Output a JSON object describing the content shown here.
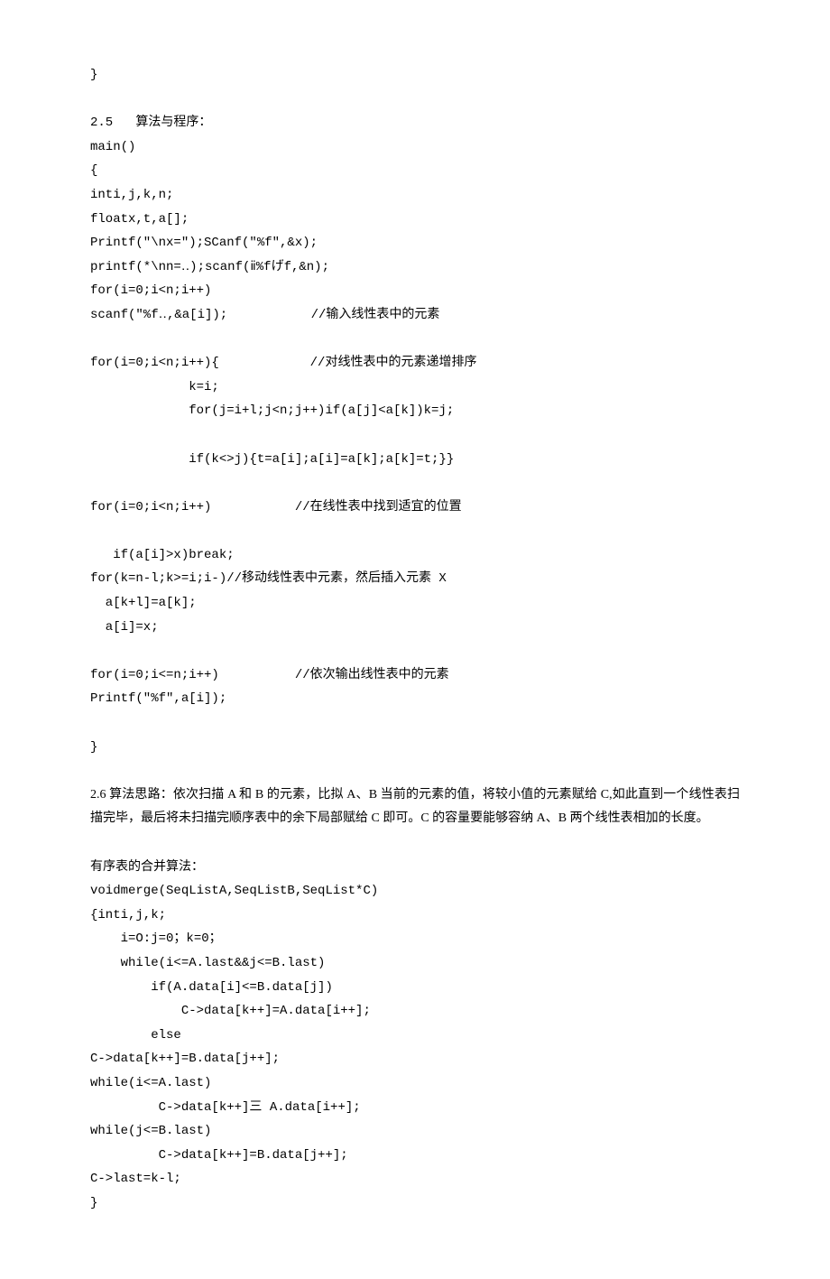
{
  "lines": [
    "}",
    "",
    "2.5   算法与程序：",
    "main()",
    "{",
    "inti,j,k,n;",
    "floatx,t,a[];",
    "Printf(\"\\nx=\");SCanf(\"%f\",&x);",
    "printf(*\\nn=‥);scanf(ⅱ%fげf,&n);",
    "for(i=0;i<n;i++)",
    "scanf(\"%f‥,&a[i]);           //输入线性表中的元素",
    "",
    "for(i=0;i<n;i++){            //对线性表中的元素递增排序",
    "             k=i;",
    "             for(j=i+l;j<n;j++)if(a[j]<a[k])k=j;",
    "",
    "             if(k<>j){t=a[i];a[i]=a[k];a[k]=t;}}",
    "",
    "for(i=0;i<n;i++)           //在线性表中找到适宜的位置",
    "",
    "   if(a[i]>x)break;",
    "for(k=n-l;k>=i;i-)//移动线性表中元素，然后插入元素 X",
    "  a[k+l]=a[k];",
    "  a[i]=x;",
    "",
    "for(i=0;i<=n;i++)          //依次输出线性表中的元素",
    "Printf(\"%f\",a[i]);",
    "",
    "}",
    ""
  ],
  "section26": {
    "heading_prefix": "2.6   算法思路：",
    "para": "依次扫描 A 和 B 的元素，比拟 A、B 当前的元素的值，将较小值的元素赋给 C,如此直到一个线性表扫描完毕，最后将未扫描完顺序表中的余下局部赋给 C 即可。C 的容量要能够容纳 A、B 两个线性表相加的长度。"
  },
  "lines2": [
    "",
    "有序表的合并算法：",
    "voidmerge(SeqListA,SeqListB,SeqList*C)",
    "{inti,j,k;",
    "    i=O:j=0；k=0；",
    "    while(i<=A.last&&j<=B.last)",
    "        if(A.data[i]<=B.data[j])",
    "            C->data[k++]=A.data[i++];",
    "        else",
    "C->data[k++]=B.data[j++];",
    "while(i<=A.last)",
    "         C->data[k++]三 A.data[i++];",
    "while(j<=B.last)",
    "         C->data[k++]=B.data[j++];",
    "C->last=k-l;",
    "}"
  ]
}
